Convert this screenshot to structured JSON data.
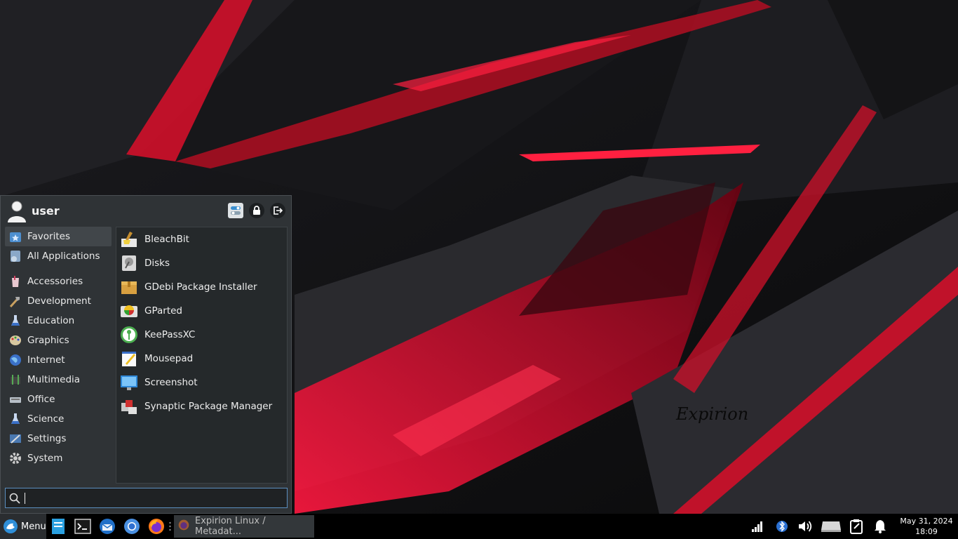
{
  "desktop": {
    "watermark": "Expirion"
  },
  "menu": {
    "user": "user",
    "header_buttons": [
      "settings-icon",
      "lock-icon",
      "logout-icon"
    ],
    "categories": [
      {
        "label": "Favorites",
        "icon": "favorites-icon",
        "active": true
      },
      {
        "label": "All Applications",
        "icon": "all-applications-icon"
      },
      {
        "label": "Accessories",
        "icon": "accessories-icon"
      },
      {
        "label": "Development",
        "icon": "development-icon"
      },
      {
        "label": "Education",
        "icon": "education-icon"
      },
      {
        "label": "Graphics",
        "icon": "graphics-icon"
      },
      {
        "label": "Internet",
        "icon": "internet-icon"
      },
      {
        "label": "Multimedia",
        "icon": "multimedia-icon"
      },
      {
        "label": "Office",
        "icon": "office-icon"
      },
      {
        "label": "Science",
        "icon": "science-icon"
      },
      {
        "label": "Settings",
        "icon": "settings-icon"
      },
      {
        "label": "System",
        "icon": "system-icon"
      }
    ],
    "apps": [
      {
        "label": "BleachBit",
        "icon": "bleachbit-icon"
      },
      {
        "label": "Disks",
        "icon": "disks-icon"
      },
      {
        "label": "GDebi Package Installer",
        "icon": "package-icon"
      },
      {
        "label": "GParted",
        "icon": "gparted-icon"
      },
      {
        "label": "KeePassXC",
        "icon": "keepassxc-icon"
      },
      {
        "label": "Mousepad",
        "icon": "mousepad-icon"
      },
      {
        "label": "Screenshot",
        "icon": "screenshot-icon"
      },
      {
        "label": "Synaptic Package Manager",
        "icon": "synaptic-icon"
      }
    ],
    "search": {
      "value": "",
      "placeholder": ""
    }
  },
  "panel": {
    "menu_label": "Menu",
    "launchers": [
      "file-manager-icon",
      "terminal-icon",
      "thunderbird-icon",
      "chromium-icon",
      "firefox-icon"
    ],
    "task": {
      "title": "Expirion Linux / Metadat..."
    },
    "tray": [
      "network-icon",
      "bluetooth-icon",
      "volume-icon",
      "drive-icon",
      "clipboard-icon",
      "notification-bell-icon"
    ],
    "clock": {
      "date": "May 31, 2024",
      "time": "18:09"
    }
  },
  "colors": {
    "accent": "#e01030",
    "panel": "#000000",
    "menu_bg": "#2f3336"
  }
}
